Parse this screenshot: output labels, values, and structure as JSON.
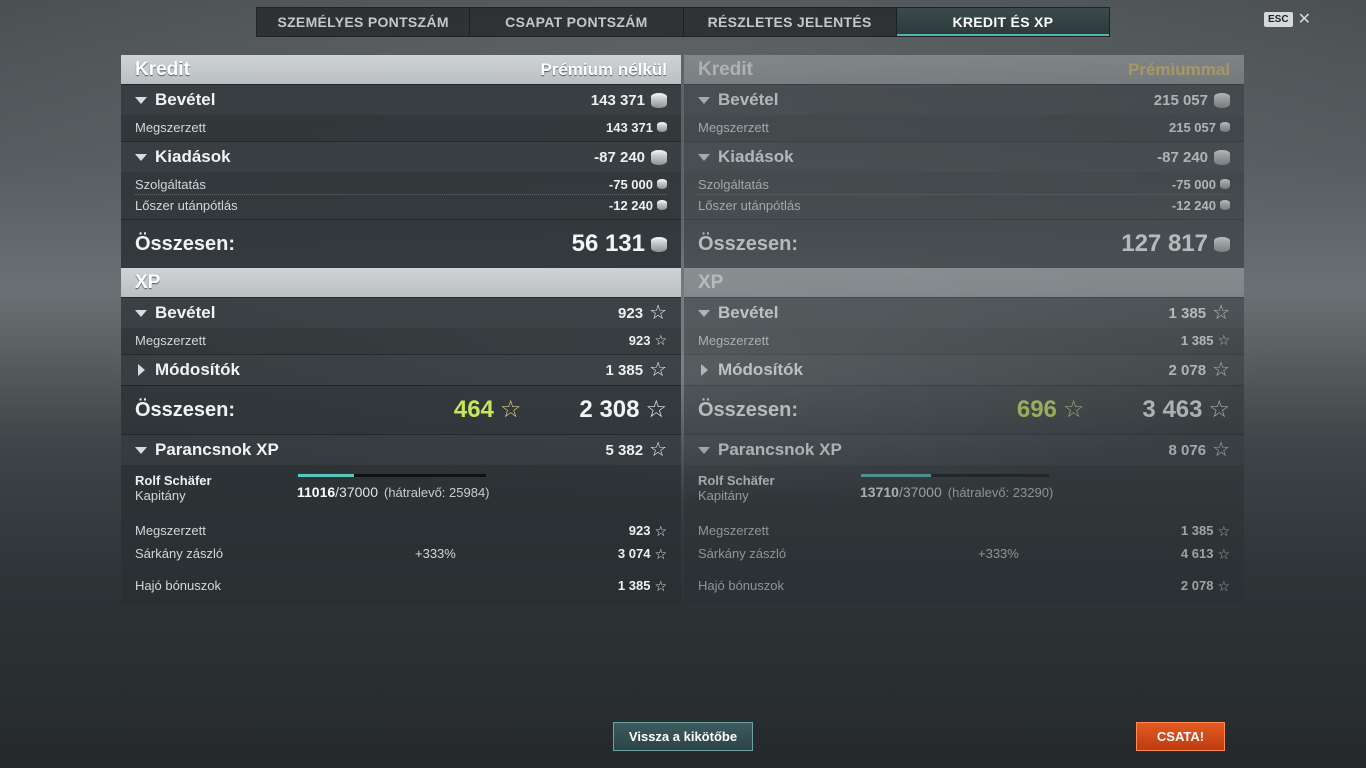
{
  "tabs": [
    "SZEMÉLYES PONTSZÁM",
    "CSAPAT PONTSZÁM",
    "RÉSZLETES JELENTÉS",
    "KREDIT ÉS XP"
  ],
  "active_tab": "KREDIT ÉS XP",
  "esc_label": "ESC",
  "close_glyph": "✕",
  "icons": {
    "credit": "credit-coin-icon",
    "xp": "star-icon"
  },
  "colors": {
    "accent": "#55c7bd",
    "bonus_xp": "#c5e65e",
    "premium": "#e4c46a",
    "battle": "#d84b18"
  },
  "panels": [
    {
      "credit_title": "Kredit",
      "variant": "Prémium nélkül",
      "income": {
        "label": "Bevétel",
        "value": "143 371"
      },
      "earned": {
        "label": "Megszerzett",
        "value": "143 371"
      },
      "expenses": {
        "label": "Kiadások",
        "value": "-87 240"
      },
      "service": {
        "label": "Szolgáltatás",
        "value": "-75 000"
      },
      "ammo": {
        "label": "Lőszer utánpótlás",
        "value": "-12 240"
      },
      "credit_total": {
        "label": "Összesen:",
        "value": "56 131"
      },
      "xp_title": "XP",
      "xp_income": {
        "label": "Bevétel",
        "value": "923"
      },
      "xp_earned": {
        "label": "Megszerzett",
        "value": "923"
      },
      "modifiers": {
        "label": "Módosítók",
        "value": "1 385"
      },
      "xp_total": {
        "label": "Összesen:",
        "bonus": "464",
        "value": "2 308"
      },
      "commander": {
        "label": "Parancsnok XP",
        "value": "5 382",
        "name": "Rolf Schäfer",
        "rank": "Kapitány",
        "progress_current": "11016",
        "progress_max": "/37000",
        "remaining": "(hátralevő: 25984)",
        "progress_fraction": 0.298,
        "earned": {
          "label": "Megszerzett",
          "value": "923"
        },
        "flag": {
          "label": "Sárkány zászló",
          "pct": "+333%",
          "value": "3 074"
        },
        "ship_bonus": {
          "label": "Hajó bónuszok",
          "value": "1 385"
        }
      }
    },
    {
      "credit_title": "Kredit",
      "variant": "Prémiummal",
      "income": {
        "label": "Bevétel",
        "value": "215 057"
      },
      "earned": {
        "label": "Megszerzett",
        "value": "215 057"
      },
      "expenses": {
        "label": "Kiadások",
        "value": "-87 240"
      },
      "service": {
        "label": "Szolgáltatás",
        "value": "-75 000"
      },
      "ammo": {
        "label": "Lőszer utánpótlás",
        "value": "-12 240"
      },
      "credit_total": {
        "label": "Összesen:",
        "value": "127 817"
      },
      "xp_title": "XP",
      "xp_income": {
        "label": "Bevétel",
        "value": "1 385"
      },
      "xp_earned": {
        "label": "Megszerzett",
        "value": "1 385"
      },
      "modifiers": {
        "label": "Módosítók",
        "value": "2 078"
      },
      "xp_total": {
        "label": "Összesen:",
        "bonus": "696",
        "value": "3 463"
      },
      "commander": {
        "label": "Parancsnok XP",
        "value": "8 076",
        "name": "Rolf Schäfer",
        "rank": "Kapitány",
        "progress_current": "13710",
        "progress_max": "/37000",
        "remaining": "(hátralevő: 23290)",
        "progress_fraction": 0.37,
        "earned": {
          "label": "Megszerzett",
          "value": "1 385"
        },
        "flag": {
          "label": "Sárkány zászló",
          "pct": "+333%",
          "value": "4 613"
        },
        "ship_bonus": {
          "label": "Hajó bónuszok",
          "value": "2 078"
        }
      }
    }
  ],
  "buttons": {
    "back_to_port": "Vissza a kikötőbe",
    "battle": "CSATA!"
  }
}
